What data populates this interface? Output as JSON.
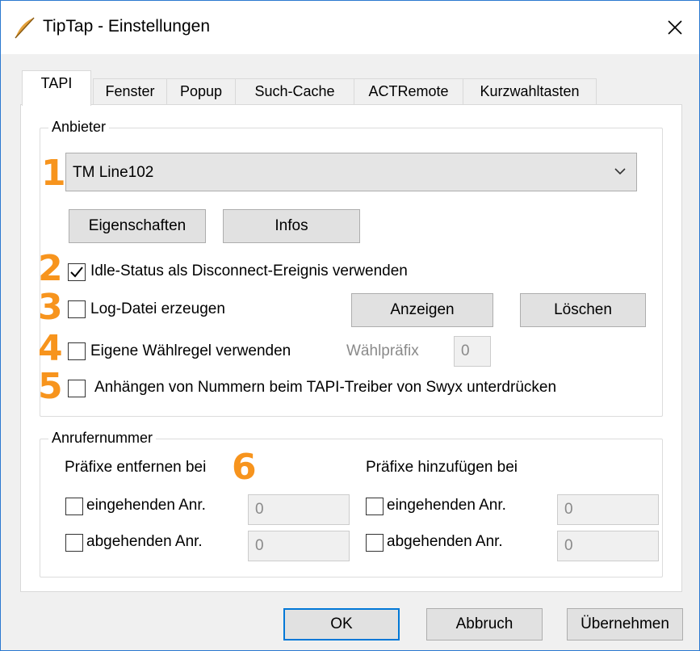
{
  "window": {
    "title": "TipTap - Einstellungen",
    "close_glyph": "✕"
  },
  "tabs": [
    {
      "label": "TAPI",
      "active": true
    },
    {
      "label": "Fenster"
    },
    {
      "label": "Popup"
    },
    {
      "label": "Such-Cache"
    },
    {
      "label": "ACTRemote"
    },
    {
      "label": "Kurzwahltasten"
    }
  ],
  "anbieter": {
    "group_label": "Anbieter",
    "provider_selected": "TM Line102",
    "eigenschaften_label": "Eigenschaften",
    "infos_label": "Infos",
    "idle_status_label": "Idle-Status als Disconnect-Ereignis verwenden",
    "idle_status_checked": true,
    "log_label": "Log-Datei erzeugen",
    "log_checked": false,
    "anzeigen_label": "Anzeigen",
    "loeschen_label": "Löschen",
    "waehlregel_label": "Eigene Wählregel verwenden",
    "waehlregel_checked": false,
    "waehlpraefix_label": "Wählpräfix",
    "waehlpraefix_value": "0",
    "anhaengen_label": "Anhängen von Nummern beim TAPI-Treiber von Swyx unterdrücken",
    "anhaengen_checked": false
  },
  "anrufernummer": {
    "group_label": "Anrufernummer",
    "remove_header": "Präfixe entfernen bei",
    "add_header": "Präfixe hinzufügen bei",
    "remove_incoming_label": "eingehenden Anr.",
    "remove_incoming_value": "0",
    "remove_outgoing_label": "abgehenden Anr.",
    "remove_outgoing_value": "0",
    "add_incoming_label": "eingehenden Anr.",
    "add_incoming_value": "0",
    "add_outgoing_label": "abgehenden Anr.",
    "add_outgoing_value": "0"
  },
  "annotations": [
    "1",
    "2",
    "3",
    "4",
    "5",
    "6"
  ],
  "footer": {
    "ok_label": "OK",
    "abbruch_label": "Abbruch",
    "uebernehmen_label": "Übernehmen"
  },
  "colors": {
    "accent": "#0078d7",
    "annotation": "#f7941d",
    "window_border": "#2b79d0"
  },
  "icons": {
    "title": "feather-pen-icon",
    "close": "close-icon",
    "dropdown": "chevron-down-icon"
  }
}
